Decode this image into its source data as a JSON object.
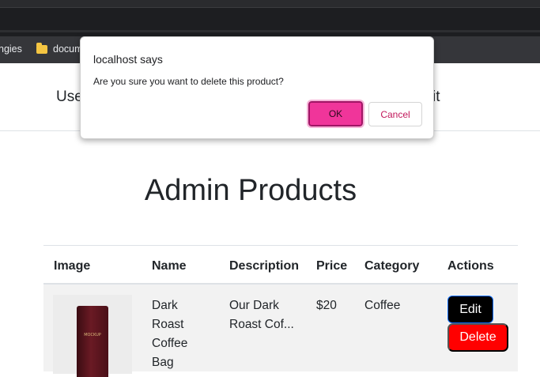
{
  "bookmarks": [
    {
      "label": "ngies"
    },
    {
      "label": "docum"
    }
  ],
  "navbar": {
    "left_text": "Use",
    "right_text": "it"
  },
  "page_title": "Admin Products",
  "table": {
    "headers": [
      "Image",
      "Name",
      "Description",
      "Price",
      "Category",
      "Actions"
    ],
    "rows": [
      {
        "image_text": "MOCKUP",
        "name_lines": [
          "Dark",
          "Roast",
          "Coffee",
          "Bag"
        ],
        "description_lines": [
          "Our Dark",
          "Roast Cof..."
        ],
        "price": "$20",
        "category": "Coffee",
        "edit_label": "Edit",
        "delete_label": "Delete"
      }
    ]
  },
  "dialog": {
    "title": "localhost says",
    "message": "Are you sure you want to delete this product?",
    "ok_label": "OK",
    "cancel_label": "Cancel"
  },
  "colors": {
    "ok_button": "#f0359a",
    "delete_button": "#ff0000",
    "edit_button": "#000000"
  }
}
